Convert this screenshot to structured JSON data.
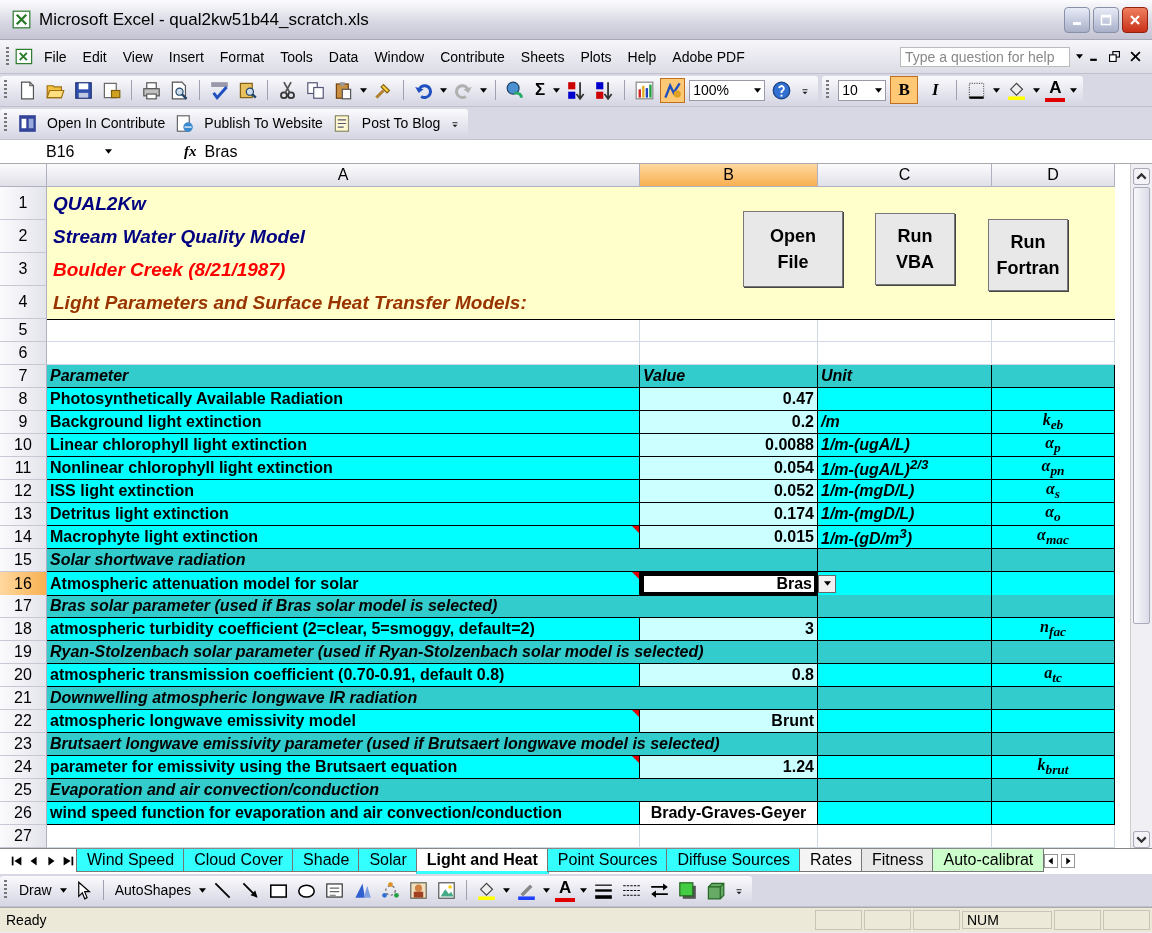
{
  "window": {
    "title": "Microsoft Excel - qual2kw51b44_scratch.xls"
  },
  "menu": [
    "File",
    "Edit",
    "View",
    "Insert",
    "Format",
    "Tools",
    "Data",
    "Window",
    "Contribute",
    "Sheets",
    "Plots",
    "Help",
    "Adobe PDF"
  ],
  "help_box": {
    "placeholder": "Type a question for help"
  },
  "toolbar": {
    "sum": "Σ",
    "zoom": "100%",
    "font_size": "10",
    "drawing_on": true,
    "bold": {
      "label": "B",
      "on": true
    },
    "italic": {
      "label": "I",
      "on": false
    },
    "font_color": "A"
  },
  "contribute_toolbar": [
    "Open In Contribute",
    "Publish To Website",
    "Post To Blog"
  ],
  "formula_bar": {
    "name_box": "B16",
    "fx": "fx",
    "value": "Bras"
  },
  "columns": [
    {
      "label": "A",
      "selected": false
    },
    {
      "label": "B",
      "selected": true
    },
    {
      "label": "C",
      "selected": false
    },
    {
      "label": "D",
      "selected": false
    }
  ],
  "title_rows": [
    {
      "number": "1",
      "text": "QUAL2Kw",
      "color": "#000080"
    },
    {
      "number": "2",
      "text": "Stream Water Quality Model",
      "color": "#000080"
    },
    {
      "number": "3",
      "text": "Boulder Creek (8/21/1987)",
      "color": "#ff0000"
    },
    {
      "number": "4",
      "text": "Light Parameters and Surface Heat Transfer Models:",
      "color": "#993300"
    }
  ],
  "sheet_buttons": [
    {
      "lines": [
        "Open",
        "File"
      ]
    },
    {
      "lines": [
        "Run",
        "VBA"
      ]
    },
    {
      "lines": [
        "Run",
        "Fortran"
      ]
    }
  ],
  "rows": [
    {
      "number": "5",
      "kind": "blank",
      "selected": false
    },
    {
      "number": "6",
      "kind": "blank",
      "selected": false
    },
    {
      "number": "7",
      "kind": "header",
      "selected": false,
      "cells": [
        "Parameter",
        "Value",
        "Unit"
      ]
    },
    {
      "number": "8",
      "kind": "param",
      "selected": false,
      "name": "Photosynthetically Available Radiation",
      "value": "0.47",
      "input": true,
      "comment": false,
      "active": false
    },
    {
      "number": "9",
      "kind": "param",
      "selected": false,
      "name": "Background light extinction",
      "value": "0.2",
      "unit": "/m",
      "symbol": "k$_{eb}$",
      "input": true,
      "comment": false,
      "active": false
    },
    {
      "number": "10",
      "kind": "param",
      "selected": false,
      "name": "Linear chlorophyll light extinction",
      "value": "0.0088",
      "unit": "1/m-(ugA/L)",
      "symbol": "α$_{p}$",
      "input": true,
      "comment": false,
      "active": false
    },
    {
      "number": "11",
      "kind": "param",
      "selected": false,
      "name": "Nonlinear chlorophyll light extinction",
      "value": "0.054",
      "unit": "1/m-(ugA/L)$^{2/3}$",
      "symbol": "α$_{pn}$",
      "input": true,
      "comment": false,
      "active": false
    },
    {
      "number": "12",
      "kind": "param",
      "selected": false,
      "name": "ISS light extinction",
      "value": "0.052",
      "unit": "1/m-(mgD/L)",
      "symbol": "α$_{s}$",
      "input": true,
      "comment": false,
      "active": false
    },
    {
      "number": "13",
      "kind": "param",
      "selected": false,
      "name": "Detritus light extinction",
      "value": "0.174",
      "unit": "1/m-(mgD/L)",
      "symbol": "α$_{o}$",
      "input": true,
      "comment": false,
      "active": false
    },
    {
      "number": "14",
      "kind": "param",
      "selected": false,
      "name": "Macrophyte light extinction",
      "value": "0.015",
      "unit": "1/m-(gD/m$^{3}$)",
      "symbol": "α$_{mac}$",
      "input": true,
      "comment": true,
      "active": false
    },
    {
      "number": "15",
      "kind": "section",
      "selected": false,
      "name": "Solar shortwave radiation"
    },
    {
      "number": "16",
      "kind": "param",
      "selected": true,
      "name": "Atmospheric attenuation model for solar",
      "value": "Bras",
      "input": true,
      "comment": true,
      "active": true
    },
    {
      "number": "17",
      "kind": "section",
      "selected": false,
      "name": "Bras solar parameter (used if Bras solar model is selected)"
    },
    {
      "number": "18",
      "kind": "param",
      "selected": false,
      "name": "atmospheric turbidity coefficient (2=clear, 5=smoggy, default=2)",
      "value": "3",
      "symbol": "n$_{fac}$",
      "input": true,
      "comment": false,
      "active": false
    },
    {
      "number": "19",
      "kind": "section",
      "selected": false,
      "name": "Ryan-Stolzenbach solar parameter (used if Ryan-Stolzenbach solar model is selected)"
    },
    {
      "number": "20",
      "kind": "param",
      "selected": false,
      "name": "atmospheric transmission coefficient (0.70-0.91, default 0.8)",
      "value": "0.8",
      "symbol": "a$_{tc}$",
      "input": true,
      "comment": false,
      "active": false
    },
    {
      "number": "21",
      "kind": "section",
      "selected": false,
      "name": "Downwelling atmospheric longwave IR radiation"
    },
    {
      "number": "22",
      "kind": "param",
      "selected": false,
      "name": "atmospheric longwave emissivity model",
      "value": "Brunt",
      "input": true,
      "comment": true,
      "active": false
    },
    {
      "number": "23",
      "kind": "section",
      "selected": false,
      "name": "Brutsaert longwave emissivity parameter (used if Brutsaert longwave model is selected)"
    },
    {
      "number": "24",
      "kind": "param",
      "selected": false,
      "name": "parameter for emissivity using the Brutsaert equation",
      "value": "1.24",
      "symbol": "k$_{brut}$",
      "input": true,
      "comment": true,
      "active": false
    },
    {
      "number": "25",
      "kind": "section",
      "selected": false,
      "name": "Evaporation and air convection/conduction"
    },
    {
      "number": "26",
      "kind": "param",
      "selected": false,
      "name": "wind speed function for evaporation and air convection/conduction",
      "value": "Brady-Graves-Geyer",
      "input": false,
      "comment": false,
      "active": false
    },
    {
      "number": "27",
      "kind": "blank",
      "selected": false
    }
  ],
  "sheet_tabs": [
    {
      "label": "Wind Speed",
      "selected": false,
      "color": "#33ffff"
    },
    {
      "label": "Cloud Cover",
      "selected": false,
      "color": "#33ffff"
    },
    {
      "label": "Shade",
      "selected": false,
      "color": "#33ffff"
    },
    {
      "label": "Solar",
      "selected": false,
      "color": "#33ffff"
    },
    {
      "label": "Light and Heat",
      "selected": true,
      "color": "#33ffff"
    },
    {
      "label": "Point Sources",
      "selected": false,
      "color": "#33ffff"
    },
    {
      "label": "Diffuse Sources",
      "selected": false,
      "color": "#33ffff"
    },
    {
      "label": "Rates",
      "selected": false,
      "color": "#f4f4f4"
    },
    {
      "label": "Fitness",
      "selected": false,
      "color": "#e8e8e8"
    },
    {
      "label": "Auto-calibrat",
      "selected": false,
      "color": "#ccffcc"
    }
  ],
  "draw_toolbar": {
    "draw": "Draw",
    "autoshapes": "AutoShapes",
    "font_color": "A"
  },
  "status_bar": {
    "text": "Ready",
    "indicator": "NUM"
  }
}
